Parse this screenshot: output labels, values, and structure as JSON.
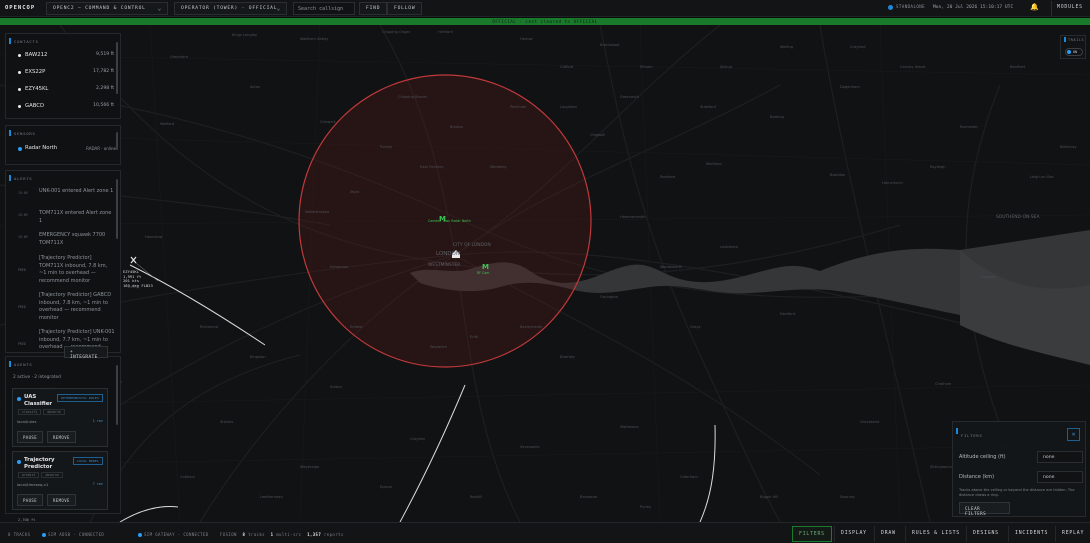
{
  "app": {
    "brand": "OPENCOP",
    "workspace": "OPENC2 — COMMAND & CONTROL",
    "role": "OPERATOR (TOWER) · OFFICIAL",
    "search_placeholder": "Search callsign",
    "find_label": "FIND",
    "follow_label": "FOLLOW",
    "standalone_label": "STANDALONE",
    "clock": "Mon, 20 Jul 2026 15:10:17 UTC",
    "modules_label": "MODULES",
    "classification_banner": "OFFICIAL · cent cleared to OFFICIAL"
  },
  "colors": {
    "accent": "#1e88d8",
    "classification": "#1a7a2c",
    "zone": "#c0393b",
    "alert_bell": "#e2b03b"
  },
  "contacts": {
    "title": "CONTACTS",
    "items": [
      {
        "callsign": "BAW212",
        "altitude": "9,519 ft"
      },
      {
        "callsign": "EXS22P",
        "altitude": "17,782 ft"
      },
      {
        "callsign": "EZY45KL",
        "altitude": "2,298 ft"
      },
      {
        "callsign": "GABCD",
        "altitude": "10,566 ft"
      }
    ]
  },
  "sensors": {
    "title": "SENSORS",
    "items": [
      {
        "name": "Radar North",
        "status": "RADAR · online"
      }
    ]
  },
  "alerts": {
    "title": "ALERTS",
    "items": [
      {
        "time": "15:09",
        "text": "UNK-001 entered Alert zone 1"
      },
      {
        "time": "15:09",
        "text": "TOM711X entered Alert zone 1"
      },
      {
        "time": "15:09",
        "text": "EMERGENCY squawk 7700 TOM711X"
      },
      {
        "time": "PRED",
        "text": "[Trajectory Predictor] TOM711X inbound, 7.8 km, ~1 min to overhead — recommend monitor"
      },
      {
        "time": "PRED",
        "text": "[Trajectory Predictor] GABCD inbound, 7.8 km, ~1 min to overhead — recommend monitor"
      },
      {
        "time": "PRED",
        "text": "[Trajectory Predictor] UNK-001 inbound, 7.7 km, ~1 min to overhead — recommend"
      }
    ]
  },
  "agents": {
    "title": "AGENTS",
    "summary_active": "2 active",
    "summary_integrated": "2 integrated",
    "integrate_label": "+ INTEGRATE",
    "items": [
      {
        "name": "UAS Classifier",
        "badge": "DETERMINISTIC RULES",
        "tags": [
          "classify",
          "observe"
        ],
        "model": "local/rules",
        "rate": "1 rec",
        "pause_label": "PAUSE",
        "remove_label": "REMOVE"
      },
      {
        "name": "Trajectory Predictor",
        "badge": "LOCAL MODEL",
        "tags": [
          "predict",
          "observe"
        ],
        "model": "local/timeseq-v1",
        "rate": "7 rec",
        "pause_label": "PAUSE",
        "remove_label": "REMOVE"
      }
    ]
  },
  "track_toggle": {
    "title": "TRAILS",
    "state": "ON"
  },
  "filters": {
    "title": "FILTERS",
    "close_label": "×",
    "altitude_label": "Altitude ceiling (ft)",
    "altitude_value": "none",
    "distance_label": "Distance (km)",
    "distance_value": "none",
    "hint": "Tracks above the ceiling or beyond the distance are hidden. The distance draws a ring.",
    "clear_label": "CLEAR FILTERS"
  },
  "map": {
    "city_label": "LONDON",
    "city_of_london": "CITY OF LONDON",
    "westminster": "WESTMINSTER",
    "southend": "SOUTHEND-ON-SEA",
    "track_label_callsign": "EZY45KL",
    "track_label_alt": "1,991 ft",
    "track_label_speed": "201 kts",
    "track_label_hdg": "180 deg",
    "track_label_flight": "FLB23",
    "landmark_1": "Camden Town Radar North",
    "landmark_2": "RF Cam",
    "scale_label": "2,700 ft",
    "places": [
      "Kings Langley",
      "Chipping Ongar",
      "Hertford",
      "Waltham Abbey",
      "Brentwood",
      "Harlow",
      "Chipping Barnet",
      "Loughton",
      "Chigwell",
      "Romford",
      "Basildon",
      "Rayleigh",
      "Wickford",
      "Hornchurch",
      "Grays",
      "Dartford",
      "Gravesend",
      "Chatham",
      "Maidstone",
      "Sevenoaks",
      "Croydon",
      "Sutton",
      "Kingston",
      "Richmond",
      "Hounslow",
      "Ealing",
      "Harrow",
      "Watford",
      "Rickmansworth",
      "Uxbridge",
      "Slough",
      "Staines",
      "Weybridge",
      "Epsom",
      "Redhill",
      "Bromley",
      "Orpington",
      "Bexleyheath",
      "Erith",
      "Woolwich",
      "Enfield",
      "Edmonton",
      "Walthamstow",
      "Ilford",
      "East Finchley",
      "Wembley",
      "Hammersmith",
      "Wandsworth",
      "Lewisham",
      "Greenwich",
      "Stratford",
      "Barking",
      "Dagenham",
      "Canvey Island",
      "Rochester",
      "Leigh-on-Sea",
      "Benfleet",
      "Billericay",
      "Thurrock",
      "Tilbury",
      "Sittingbourne",
      "Swanley",
      "Biggin Hill",
      "Caterham",
      "Purley",
      "Banstead",
      "Leatherhead",
      "Cobham",
      "Esher",
      "Twickenham",
      "Feltham",
      "Heathrow",
      "Hayes",
      "Northolt",
      "Greenford",
      "Acton",
      "Chiswick",
      "Putney",
      "Brixton",
      "Peckham",
      "Catford",
      "Eltham",
      "Sidcup",
      "Welling",
      "Crayford"
    ]
  },
  "bottom": {
    "tracks": "8 TRACKS",
    "sim_adsb_label": "SIM ADSB",
    "sim_adsb_state": "CONNECTED",
    "sim_gateway_label": "SIM GATEWAY",
    "sim_gateway_state": "CONNECTED",
    "fusion_label": "FUSION",
    "fusion_tracks": "8",
    "fusion_tracks_label": "tracks",
    "fusion_multi": "1",
    "fusion_multi_label": "multi-src",
    "fusion_reports": "1,357",
    "fusion_reports_label": "reports",
    "buttons": [
      "FILTERS",
      "DISPLAY",
      "DRAW",
      "RULES & LISTS",
      "DESIGNS",
      "INCIDENTS",
      "REPLAY"
    ]
  }
}
